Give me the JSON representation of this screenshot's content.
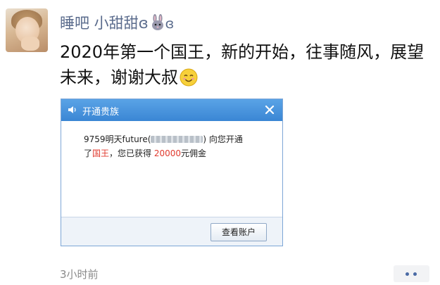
{
  "post": {
    "username": "睡吧 小甜甜",
    "username_suffix": "ɞ",
    "text": "2020年第一个国王，新的开始，往事随风，展望未来，谢谢大叔",
    "timestamp": "3小时前"
  },
  "dialog": {
    "title": "开通贵族",
    "line1_prefix": "9759明天future(",
    "line1_suffix": ") 向您开通",
    "line2_a": "了",
    "line2_king": "国王",
    "line2_b": "，您已获得 ",
    "line2_amount": "20000",
    "line2_c": "元佣金",
    "button_label": "查看账户"
  },
  "colors": {
    "username": "#5a6b8c",
    "dialog_titlebar": "#3a86d4",
    "highlight": "#e03a2e",
    "more_dots": "#4a6aa5"
  },
  "icons": [
    "bunny-icon",
    "smile-icon",
    "speaker-icon",
    "close-icon",
    "more-dots-icon"
  ]
}
